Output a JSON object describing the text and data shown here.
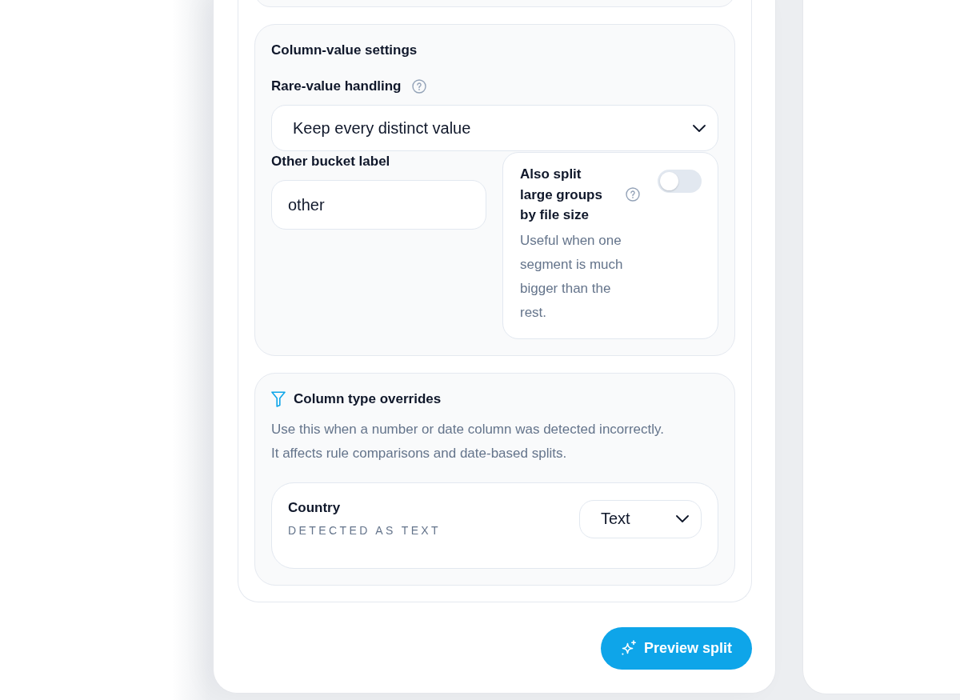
{
  "column_value_settings": {
    "title": "Column-value settings",
    "rare_value_handling": {
      "label": "Rare-value handling",
      "value": "Keep every distinct value"
    },
    "other_bucket_label": {
      "label": "Other bucket label",
      "value": "other"
    },
    "split_by_size": {
      "title": "Also split large groups by file size",
      "on": false,
      "description": "Useful when one segment is much bigger than the rest."
    }
  },
  "column_type_overrides": {
    "title": "Column type overrides",
    "description": [
      "Use this when a number or date column was detected incorrectly.",
      "It affects rule comparisons and date-based splits."
    ],
    "columns": [
      {
        "name": "Country",
        "detected": "DETECTED AS TEXT",
        "type": "Text"
      }
    ]
  },
  "preview_button": {
    "label": "Preview split"
  }
}
